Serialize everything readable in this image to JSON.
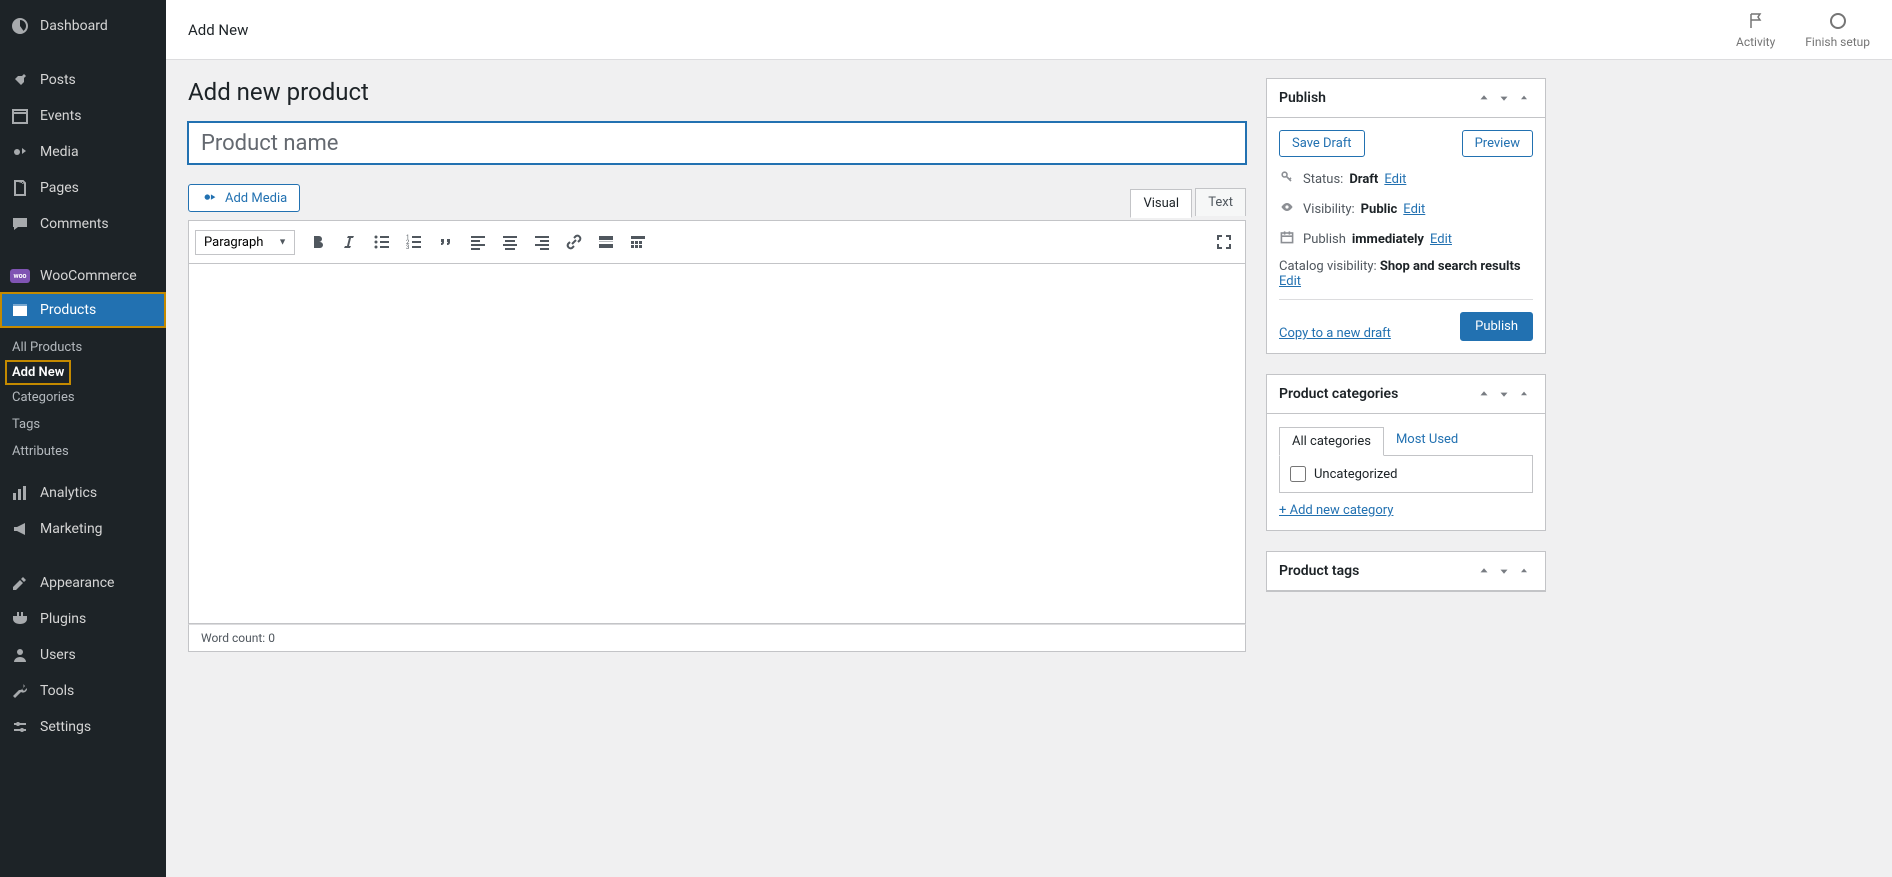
{
  "sidebar": {
    "items": [
      {
        "label": "Dashboard",
        "icon": "dashboard"
      },
      {
        "label": "Posts",
        "icon": "pin"
      },
      {
        "label": "Events",
        "icon": "calendar"
      },
      {
        "label": "Media",
        "icon": "media"
      },
      {
        "label": "Pages",
        "icon": "page"
      },
      {
        "label": "Comments",
        "icon": "comment"
      },
      {
        "label": "WooCommerce",
        "icon": "woo"
      },
      {
        "label": "Products",
        "icon": "product",
        "active": true,
        "highlighted": true
      },
      {
        "label": "Analytics",
        "icon": "analytics"
      },
      {
        "label": "Marketing",
        "icon": "marketing"
      },
      {
        "label": "Appearance",
        "icon": "appearance"
      },
      {
        "label": "Plugins",
        "icon": "plugins"
      },
      {
        "label": "Users",
        "icon": "users"
      },
      {
        "label": "Tools",
        "icon": "tools"
      },
      {
        "label": "Settings",
        "icon": "settings"
      }
    ],
    "submenu": {
      "items": [
        "All Products",
        "Add New",
        "Categories",
        "Tags",
        "Attributes"
      ],
      "current": "Add New"
    }
  },
  "topbar": {
    "title": "Add New",
    "actions": {
      "activity": "Activity",
      "finish": "Finish setup"
    }
  },
  "page": {
    "heading": "Add new product",
    "title_placeholder": "Product name"
  },
  "editor": {
    "add_media": "Add Media",
    "tabs": {
      "visual": "Visual",
      "text": "Text"
    },
    "format": "Paragraph",
    "word_count_label": "Word count:",
    "word_count": "0"
  },
  "publish": {
    "title": "Publish",
    "save_draft": "Save Draft",
    "preview": "Preview",
    "status_label": "Status:",
    "status_value": "Draft",
    "visibility_label": "Visibility:",
    "visibility_value": "Public",
    "publish_label": "Publish",
    "publish_value": "immediately",
    "edit": "Edit",
    "catalog_label": "Catalog visibility:",
    "catalog_value": "Shop and search results",
    "copy_link": "Copy to a new draft",
    "publish_btn": "Publish"
  },
  "categories": {
    "title": "Product categories",
    "tab_all": "All categories",
    "tab_most": "Most Used",
    "uncat": "Uncategorized",
    "add_new": "+ Add new category"
  },
  "tags": {
    "title": "Product tags"
  }
}
